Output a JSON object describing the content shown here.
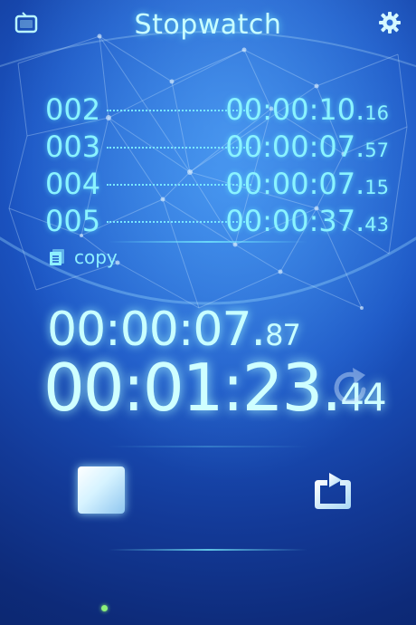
{
  "header": {
    "title": "Stopwatch",
    "left_icon": "tv-icon",
    "right_icon": "gear-icon"
  },
  "laps": [
    {
      "number": "002",
      "time_main": "00:00:10.",
      "time_frac": "16"
    },
    {
      "number": "003",
      "time_main": "00:00:07.",
      "time_frac": "57"
    },
    {
      "number": "004",
      "time_main": "00:00:07.",
      "time_frac": "15"
    },
    {
      "number": "005",
      "time_main": "00:00:37.",
      "time_frac": "43"
    }
  ],
  "copy": {
    "label": "copy",
    "icon": "document-copy-icon"
  },
  "current_lap": {
    "main": "00:00:07.",
    "frac": "87"
  },
  "total": {
    "main": "00:01:23.",
    "frac": "44"
  },
  "controls": {
    "reset_icon": "reset-icon",
    "stop_icon": "stop-icon",
    "lap_icon": "lap-icon"
  },
  "colors": {
    "accent": "#8af3ff",
    "background": "#1b55c4",
    "indicator": "#8cf07a"
  }
}
